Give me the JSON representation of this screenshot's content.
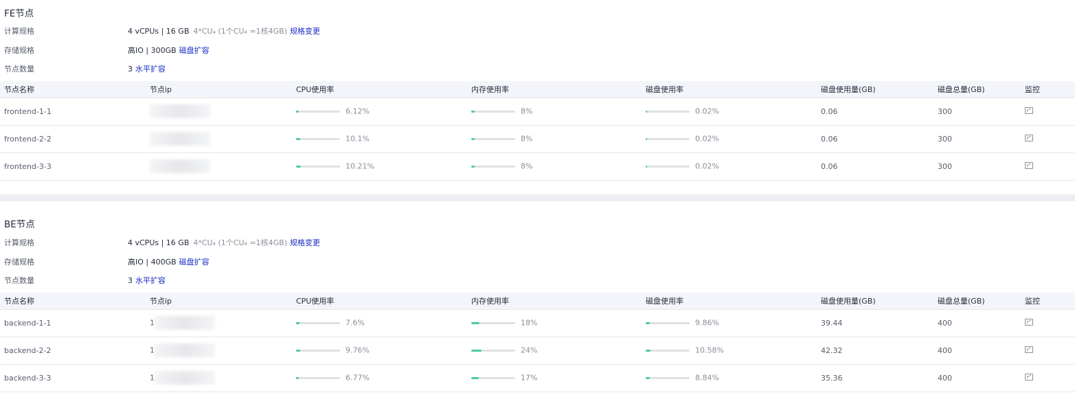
{
  "fe": {
    "title": "FE节点",
    "compute_label": "计算规格",
    "compute_value": "4 vCPUs | 16 GB",
    "compute_note": "4*CU₄ (1个CU₄ =1核4GB)",
    "compute_link": "规格变更",
    "storage_label": "存储规格",
    "storage_value": "高IO | 300GB",
    "storage_link": "磁盘扩容",
    "count_label": "节点数量",
    "count_value": "3",
    "count_link": "水平扩容",
    "columns": [
      "节点名称",
      "节点ip",
      "CPU使用率",
      "内存使用率",
      "磁盘使用率",
      "磁盘使用量(GB)",
      "磁盘总量(GB)",
      "监控"
    ],
    "rows": [
      {
        "name": "frontend-1-1",
        "ip": "",
        "cpu": 6.12,
        "cpu_text": "6.12%",
        "mem": 8,
        "mem_text": "8%",
        "disk": 0.02,
        "disk_text": "0.02%",
        "used": "0.06",
        "total": "300"
      },
      {
        "name": "frontend-2-2",
        "ip": "",
        "cpu": 10.1,
        "cpu_text": "10.1%",
        "mem": 8,
        "mem_text": "8%",
        "disk": 0.02,
        "disk_text": "0.02%",
        "used": "0.06",
        "total": "300"
      },
      {
        "name": "frontend-3-3",
        "ip": "",
        "cpu": 10.21,
        "cpu_text": "10.21%",
        "mem": 8,
        "mem_text": "8%",
        "disk": 0.02,
        "disk_text": "0.02%",
        "used": "0.06",
        "total": "300"
      }
    ]
  },
  "be": {
    "title": "BE节点",
    "compute_label": "计算规格",
    "compute_value": "4 vCPUs | 16 GB",
    "compute_note": "4*CU₄ (1个CU₄ =1核4GB)",
    "compute_link": "规格变更",
    "storage_label": "存储规格",
    "storage_value": "高IO | 400GB",
    "storage_link": "磁盘扩容",
    "count_label": "节点数量",
    "count_value": "3",
    "count_link": "水平扩容",
    "columns": [
      "节点名称",
      "节点ip",
      "CPU使用率",
      "内存使用率",
      "磁盘使用率",
      "磁盘使用量(GB)",
      "磁盘总量(GB)",
      "监控"
    ],
    "rows": [
      {
        "name": "backend-1-1",
        "ip": "1",
        "cpu": 7.6,
        "cpu_text": "7.6%",
        "mem": 18,
        "mem_text": "18%",
        "disk": 9.86,
        "disk_text": "9.86%",
        "used": "39.44",
        "total": "400"
      },
      {
        "name": "backend-2-2",
        "ip": "1",
        "cpu": 9.76,
        "cpu_text": "9.76%",
        "mem": 24,
        "mem_text": "24%",
        "disk": 10.58,
        "disk_text": "10.58%",
        "used": "42.32",
        "total": "400"
      },
      {
        "name": "backend-3-3",
        "ip": "1",
        "cpu": 6.77,
        "cpu_text": "6.77%",
        "mem": 17,
        "mem_text": "17%",
        "disk": 8.84,
        "disk_text": "8.84%",
        "used": "35.36",
        "total": "400"
      }
    ]
  },
  "icons": {
    "monitor": "monitor-chart-icon"
  },
  "colors": {
    "accent": "#1a2cc4",
    "bar_fill": "#4bc9a2",
    "bar_track": "#dfe1e6",
    "header_bg": "#f4f5fa"
  }
}
